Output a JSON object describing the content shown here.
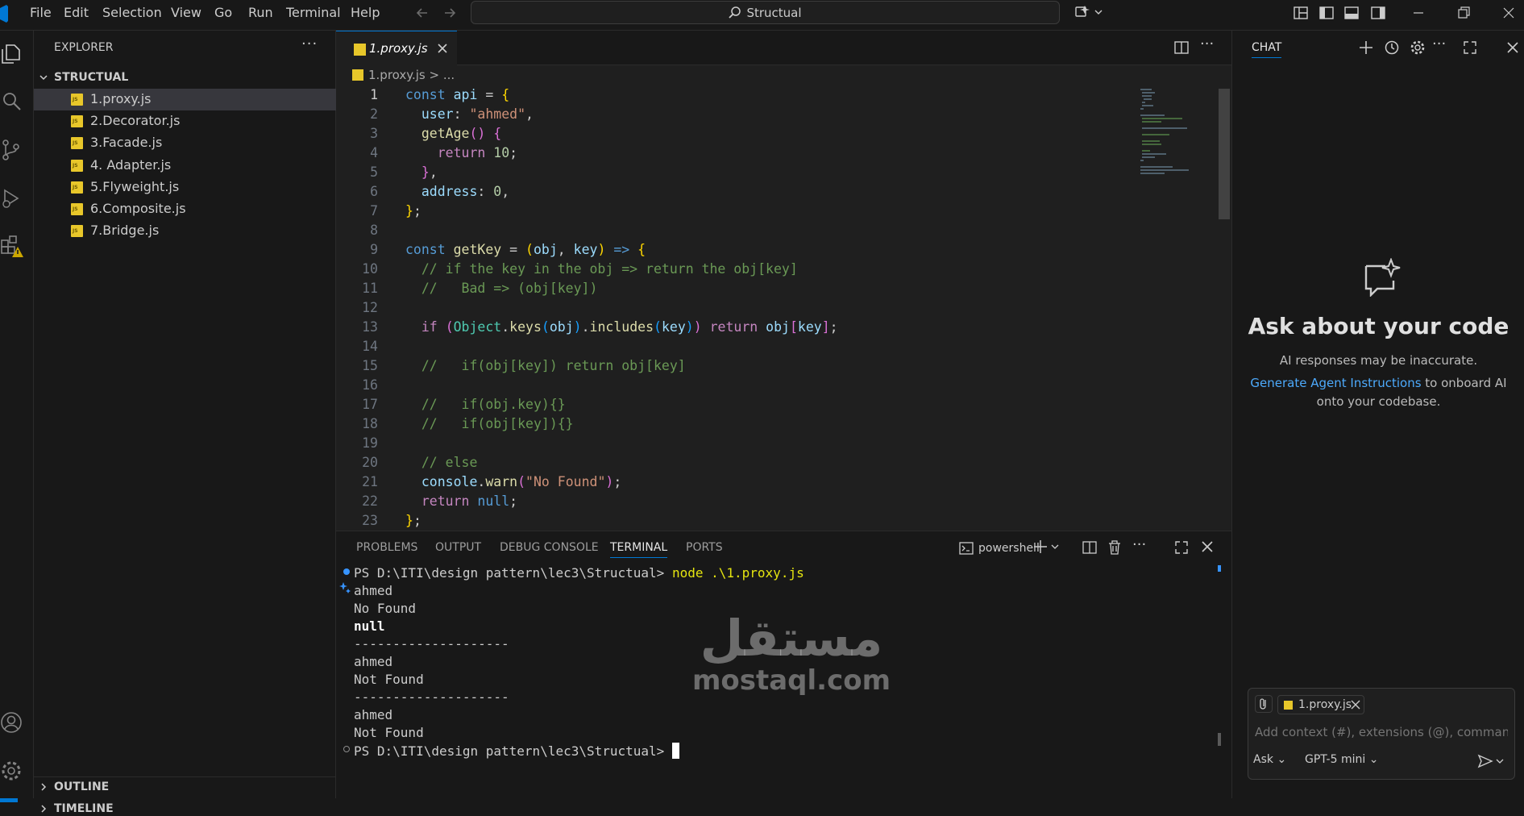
{
  "menu": [
    "File",
    "Edit",
    "Selection",
    "View",
    "Go",
    "Run",
    "Terminal",
    "Help"
  ],
  "search": {
    "label": "Structual"
  },
  "explorer": {
    "title": "EXPLORER",
    "folder": "STRUCTUAL",
    "files": [
      "1.proxy.js",
      "2.Decorator.js",
      "3.Facade.js",
      "4. Adapter.js",
      "5.Flyweight.js",
      "6.Composite.js",
      "7.Bridge.js"
    ],
    "outline": "OUTLINE",
    "timeline": "TIMELINE"
  },
  "editor": {
    "tab": "1.proxy.js",
    "breadcrumb_file": "1.proxy.js",
    "breadcrumb_sep": "> ...",
    "line_numbers": [
      "1",
      "2",
      "3",
      "4",
      "5",
      "6",
      "7",
      "8",
      "9",
      "10",
      "11",
      "12",
      "13",
      "14",
      "15",
      "16",
      "17",
      "18",
      "19",
      "20",
      "21",
      "22",
      "23"
    ]
  },
  "panel": {
    "tabs": [
      "PROBLEMS",
      "OUTPUT",
      "DEBUG CONSOLE",
      "TERMINAL",
      "PORTS"
    ],
    "active_tab": "TERMINAL",
    "shell": "powershell",
    "terminal_lines": [
      "PS D:\\ITI\\design pattern\\lec3\\Structual> ",
      "ahmed",
      "No Found",
      "null",
      "--------------------",
      "ahmed",
      "Not Found",
      "--------------------",
      "ahmed",
      "Not Found",
      "PS D:\\ITI\\design pattern\\lec3\\Structual> "
    ],
    "command": "node .\\1.proxy.js"
  },
  "chat": {
    "title": "CHAT",
    "heading": "Ask about your code",
    "disclaimer": "AI responses may be inaccurate.",
    "link": "Generate Agent Instructions",
    "link_suffix": " to onboard AI",
    "line3": "onto your codebase.",
    "context_file": "1.proxy.js",
    "placeholder": "Add context (#), extensions (@), commands",
    "mode": "Ask",
    "model": "GPT-5 mini"
  },
  "watermark": {
    "arabic": "مستقل",
    "latin": "mostaql.com"
  },
  "colors": {
    "accent": "#0078d4",
    "js_icon": "#e8c72a",
    "warning": "#cca700"
  }
}
